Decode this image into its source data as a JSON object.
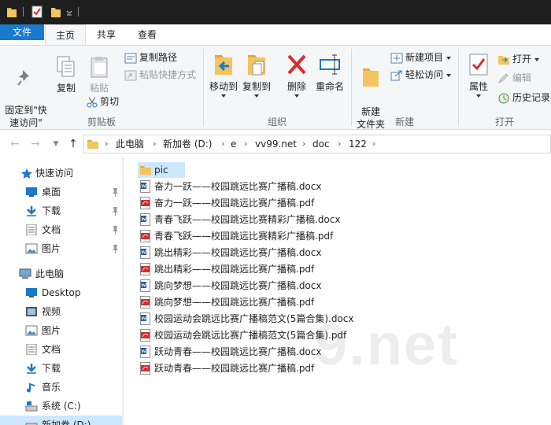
{
  "titlebar": {
    "icons": [
      "folder-icon",
      "properties-icon",
      "new-folder-icon",
      "customize-caret-icon"
    ]
  },
  "ribbon_tabs": [
    {
      "label": "文件"
    },
    {
      "label": "主页"
    },
    {
      "label": "共享"
    },
    {
      "label": "查看"
    }
  ],
  "ribbon": {
    "clipboard": {
      "pin_quick_access": "固定到\"快\n速访问\"",
      "copy": "复制",
      "paste": "粘贴",
      "copy_path": "复制路径",
      "paste_shortcut": "粘贴快捷方式",
      "cut": "剪切",
      "group_label": "剪贴板"
    },
    "organize": {
      "move_to": "移动到",
      "copy_to": "复制到",
      "delete": "删除",
      "rename": "重命名",
      "group_label": "组织"
    },
    "new": {
      "new_folder": "新建\n文件夹",
      "new_item": "新建项目",
      "easy_access": "轻松访问",
      "group_label": "新建"
    },
    "open": {
      "properties": "属性",
      "open": "打开",
      "edit": "编辑",
      "history": "历史记录",
      "group_label": "打开"
    }
  },
  "address": {
    "breadcrumbs": [
      "此电脑",
      "新加卷 (D:)",
      "e",
      "vv99.net",
      "doc",
      "122"
    ]
  },
  "navpane": {
    "quick_access": "快速访问",
    "quick_items": [
      "桌面",
      "下载",
      "文档",
      "图片"
    ],
    "this_pc": "此电脑",
    "pc_items": [
      "Desktop",
      "视频",
      "图片",
      "文档",
      "下载",
      "音乐",
      "系统 (C:)",
      "新加卷 (D:)"
    ]
  },
  "files": [
    {
      "name": "pic",
      "type": "folder"
    },
    {
      "name": "奋力一跃——校园跳远比赛广播稿.docx",
      "type": "docx"
    },
    {
      "name": "奋力一跃——校园跳远比赛广播稿.pdf",
      "type": "pdf"
    },
    {
      "name": "青春飞跃——校园跳远比赛精彩广播稿.docx",
      "type": "docx"
    },
    {
      "name": "青春飞跃——校园跳远比赛精彩广播稿.pdf",
      "type": "pdf"
    },
    {
      "name": "跳出精彩——校园跳远比赛广播稿.docx",
      "type": "docx"
    },
    {
      "name": "跳出精彩——校园跳远比赛广播稿.pdf",
      "type": "pdf"
    },
    {
      "name": "跳向梦想——校园跳远比赛广播稿.docx",
      "type": "docx"
    },
    {
      "name": "跳向梦想——校园跳远比赛广播稿.pdf",
      "type": "pdf"
    },
    {
      "name": "校园运动会跳远比赛广播稿范文(5篇合集).docx",
      "type": "docx"
    },
    {
      "name": "校园运动会跳远比赛广播稿范文(5篇合集).pdf",
      "type": "pdf"
    },
    {
      "name": "跃动青春——校园跳远比赛广播稿.docx",
      "type": "docx"
    },
    {
      "name": "跃动青春——校园跳远比赛广播稿.pdf",
      "type": "pdf"
    }
  ],
  "watermark": "9.net",
  "colors": {
    "accent": "#1979ca",
    "selection": "#cce8ff",
    "ribbon_bg": "#f5f6f7",
    "titlebar": "#1e1e1e",
    "folder": "#f4c55c",
    "word": "#2b5797",
    "pdf": "#d32f2f"
  }
}
